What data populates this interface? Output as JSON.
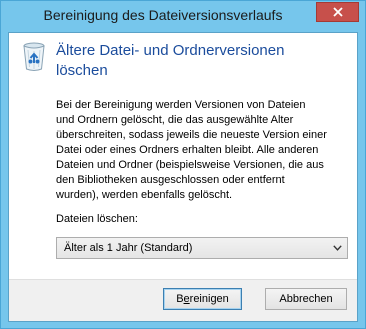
{
  "window": {
    "title": "Bereinigung des Dateiversionsverlaufs"
  },
  "content": {
    "heading_line1": "Ältere Datei- und Ordnerversionen",
    "heading_line2": "löschen",
    "description_lines": [
      "Bei der Bereinigung werden Versionen von Dateien",
      "und Ordnern gelöscht, die das ausgewählte Alter",
      "überschreiten, sodass jeweils die neueste Version einer",
      "Datei oder eines Ordners erhalten bleibt. Alle anderen",
      "Dateien und Ordner (beispielsweise Versionen, die aus",
      "den Bibliotheken ausgeschlossen oder entfernt",
      "wurden), werden ebenfalls gelöscht."
    ],
    "delete_label": "Dateien löschen:",
    "age_select_value": "Älter als 1 Jahr (Standard)"
  },
  "buttons": {
    "cleanup_prefix": "B",
    "cleanup_accel": "e",
    "cleanup_suffix": "reinigen",
    "cancel": "Abbrechen"
  },
  "icons": {
    "main": "recycle-bin-icon",
    "close": "close-icon",
    "dropdown": "chevron-down-icon"
  },
  "colors": {
    "frame": "#76c6ec",
    "heading": "#1b4c9c",
    "close_button": "#c7504b"
  }
}
